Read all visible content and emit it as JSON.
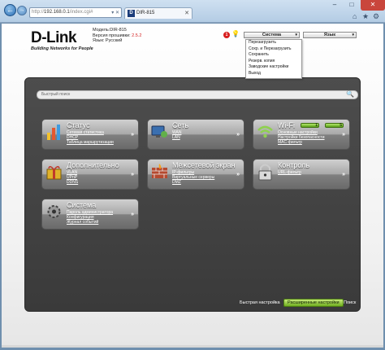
{
  "browser": {
    "address": "http://192.168.0.1/index.cgi#",
    "address_scheme": "http://",
    "address_host": "192.168.0.1",
    "address_rest": "/index.cgi#",
    "tab_title": "DIR-815",
    "tab_logo": "D",
    "back_icon": "←",
    "forward_icon": "→",
    "addr_icons": "▾ ✕",
    "tab_close": "✕",
    "min_icon": "–",
    "max_icon": "□",
    "close_icon": "✕",
    "home_icon": "⌂",
    "star_icon": "★",
    "gear_icon": "⚙",
    "close_color": "#c9463c"
  },
  "header": {
    "logo": "D-Link",
    "tagline": "Building Networks for People",
    "model_line": "Модель:DIR-815",
    "firmware_label": "Версия прошивки:",
    "firmware_value": "2.5.2",
    "language_line": "Язык: Русский",
    "hint_count": "1",
    "bulb_icon": "💡",
    "system_select": "Система",
    "language_select": "Язык",
    "select_arrow": "▾"
  },
  "system_menu": [
    "Перезагрузить",
    "Сохр. и Перезагрузить",
    "Сохранить",
    "Резерв. копия",
    "Заводские настройки",
    "Выход"
  ],
  "search": {
    "placeholder": "Быстрый поиск",
    "icon": "🔍"
  },
  "tiles": {
    "status": {
      "title": "Статус",
      "links": [
        "Сетевая статистика",
        "DHCP",
        "Таблица маршрутизации"
      ]
    },
    "network": {
      "title": "Сеть",
      "links": [
        "WAN",
        "LAN"
      ]
    },
    "wifi": {
      "title": "Wi-Fi",
      "links": [
        "Основные настройки",
        "Настройки безопасности",
        "MAC-фильтр"
      ],
      "toggles": [
        "1",
        "5"
      ]
    },
    "additional": {
      "title": "Дополнительно",
      "links": [
        "VLAN",
        "UPnP",
        "DDNS"
      ]
    },
    "firewall": {
      "title": "Межсетевой экран",
      "links": [
        "IP-фильтры",
        "Виртуальные серверы",
        "DMZ"
      ]
    },
    "control": {
      "title": "Контроль",
      "links": [
        "URL-фильтр"
      ]
    },
    "system": {
      "title": "Система",
      "links": [
        "Пароль администратора",
        "Конфигурация",
        "Журнал событий"
      ]
    }
  },
  "tile_arrow": "»",
  "bottom": {
    "quick": "Быстрая настройка",
    "advanced": "Расширенные настройки",
    "search": "Поиск"
  },
  "colors": {
    "panel": "#404040",
    "accent_green": "#6fae1f",
    "firmware_red": "#d32222"
  }
}
